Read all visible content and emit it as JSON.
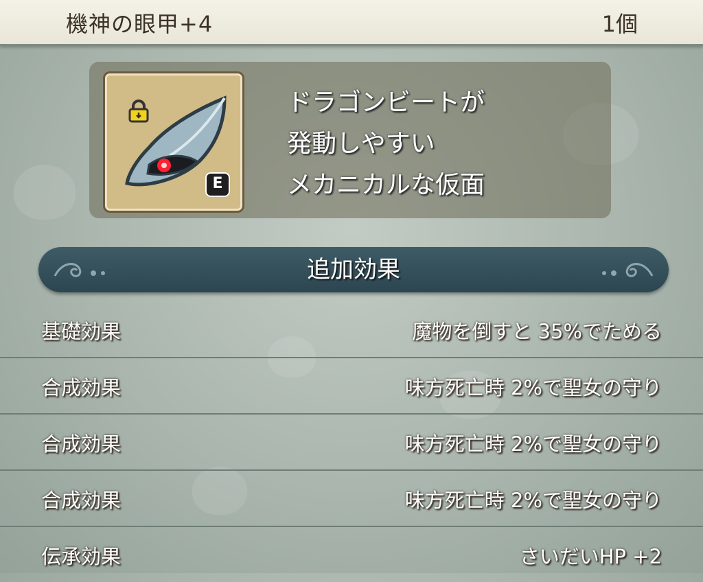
{
  "item": {
    "name": "機神の眼甲+4",
    "count": "1個",
    "icon": "mechanical-mask-icon",
    "equipped_badge": "E",
    "lock_icon": "lock-icon",
    "description_lines": [
      "ドラゴンビートが",
      "発動しやすい",
      "メカニカルな仮面"
    ]
  },
  "effects": {
    "section_title": "追加効果",
    "rows": [
      {
        "label": "基礎効果",
        "value": "魔物を倒すと 35%でためる"
      },
      {
        "label": "合成効果",
        "value": "味方死亡時 2%で聖女の守り"
      },
      {
        "label": "合成効果",
        "value": "味方死亡時 2%で聖女の守り"
      },
      {
        "label": "合成効果",
        "value": "味方死亡時 2%で聖女の守り"
      },
      {
        "label": "伝承効果",
        "value": "さいだいHP +2"
      }
    ]
  },
  "colors": {
    "header_bg": "#f4f2e8",
    "section_bar": "#2c4651",
    "icon_frame": "#d1bb86",
    "text": "#ffffff"
  }
}
